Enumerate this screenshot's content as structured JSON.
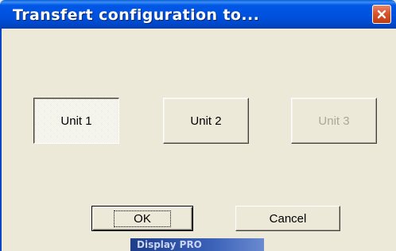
{
  "window": {
    "title": "Transfert configuration to...",
    "title_bar_color": "#0050dd",
    "close_icon": "close-icon"
  },
  "units": [
    {
      "label": "Unit 1",
      "state": "pressed"
    },
    {
      "label": "Unit 2",
      "state": "normal"
    },
    {
      "label": "Unit 3",
      "state": "disabled"
    }
  ],
  "buttons": {
    "ok": "OK",
    "cancel": "Cancel"
  },
  "background_window": {
    "partial_title": "Display PRO"
  },
  "colors": {
    "dialog_bg": "#ece9d8",
    "disabled_text": "#aca899"
  }
}
